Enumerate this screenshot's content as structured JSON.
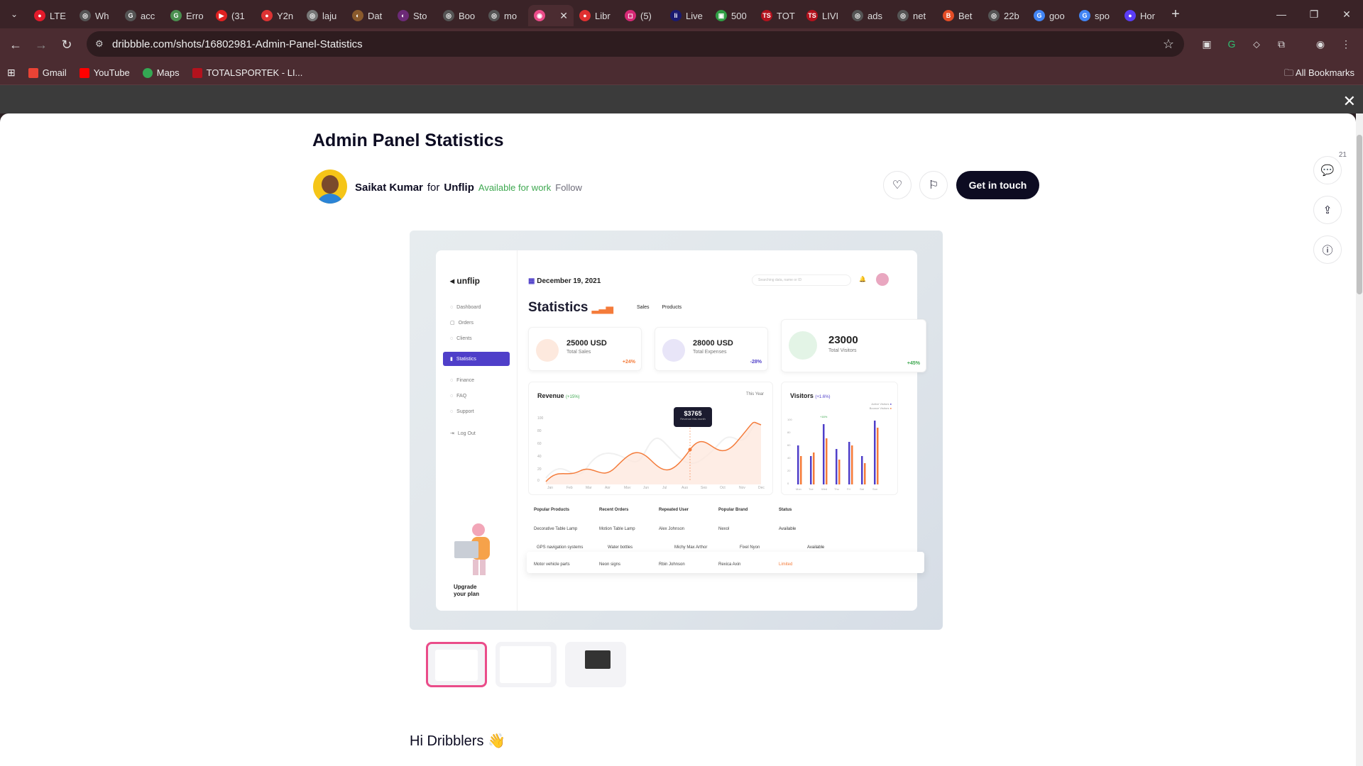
{
  "browser": {
    "tabs": [
      {
        "label": "LTE",
        "color": "#e21b2b",
        "glyph": "●"
      },
      {
        "label": "Wh",
        "color": "#555555",
        "glyph": "◎"
      },
      {
        "label": "acc",
        "color": "#555555",
        "glyph": "G"
      },
      {
        "label": "Erro",
        "color": "#4a8f4f",
        "glyph": "G"
      },
      {
        "label": "(31",
        "color": "#e02121",
        "glyph": "▶"
      },
      {
        "label": "Y2n",
        "color": "#d33",
        "glyph": "●"
      },
      {
        "label": "laju",
        "color": "#777777",
        "glyph": "◎"
      },
      {
        "label": "Dat",
        "color": "#8a5a2c",
        "glyph": "◐"
      },
      {
        "label": "Sto",
        "color": "#6c2a77",
        "glyph": "◐"
      },
      {
        "label": "Boo",
        "color": "#555555",
        "glyph": "◎"
      },
      {
        "label": "mo",
        "color": "#555555",
        "glyph": "◎"
      },
      {
        "label": "",
        "color": "#ea4c89",
        "glyph": "◉",
        "active": true
      },
      {
        "label": "Libr",
        "color": "#e03030",
        "glyph": "●"
      },
      {
        "label": "(5)",
        "color": "#d62976",
        "glyph": "◻"
      },
      {
        "label": "Live",
        "color": "#1a1a70",
        "glyph": "li"
      },
      {
        "label": "500",
        "color": "#2f9e44",
        "glyph": "▣"
      },
      {
        "label": "TOT",
        "color": "#b3121d",
        "glyph": "TS"
      },
      {
        "label": "LIVI",
        "color": "#b3121d",
        "glyph": "TS"
      },
      {
        "label": "ads",
        "color": "#555555",
        "glyph": "◎"
      },
      {
        "label": "net",
        "color": "#555555",
        "glyph": "◎"
      },
      {
        "label": "Bet",
        "color": "#e44d26",
        "glyph": "B"
      },
      {
        "label": "22b",
        "color": "#555555",
        "glyph": "◎"
      },
      {
        "label": "goo",
        "color": "#4285f4",
        "glyph": "G"
      },
      {
        "label": "spo",
        "color": "#4285f4",
        "glyph": "G"
      },
      {
        "label": "Hor",
        "color": "#5b3df5",
        "glyph": "●"
      }
    ],
    "url": "dribbble.com/shots/16802981-Admin-Panel-Statistics",
    "bookmarks": [
      {
        "label": "Gmail",
        "color": "#ea4335"
      },
      {
        "label": "YouTube",
        "color": "#ff0000"
      },
      {
        "label": "Maps",
        "color": "#34a853"
      },
      {
        "label": "TOTALSPORTEK - LI...",
        "color": "#b3121d"
      }
    ],
    "all_bookmarks": "All Bookmarks"
  },
  "shot": {
    "title": "Admin Panel Statistics",
    "author": "Saikat Kumar",
    "for_word": "for",
    "team": "Unflip",
    "availability": "Available for work",
    "follow": "Follow",
    "contact": "Get in touch",
    "comment_count": "21",
    "intro": "Hi Dribblers 👋"
  },
  "dashboard": {
    "logo": "unflip",
    "date": "December 19, 2021",
    "search_placeholder": "Searching data, name or ID",
    "title": "Statistics",
    "tabs": [
      "Sales",
      "Products"
    ],
    "nav": [
      "Dashboard",
      "Orders",
      "Clients",
      "Statistics",
      "Finance",
      "FAQ",
      "Support",
      "Log Out"
    ],
    "kpis": [
      {
        "value": "25000 USD",
        "label": "Total Sales",
        "change": "+24%",
        "color": "#f47b3a"
      },
      {
        "value": "28000 USD",
        "label": "Total Expenses",
        "change": "-28%",
        "color": "#4f3fc9"
      },
      {
        "value": "23000",
        "label": "Total Visitors",
        "change": "+45%",
        "color": "#3ea850"
      }
    ],
    "revenue": {
      "title": "Revenue",
      "change": "(+15%)",
      "period": "This Year",
      "tooltip": "$3765",
      "tooltip_sub": "Revenue this month"
    },
    "visitors": {
      "title": "Visitors",
      "change": "(+1.6%)",
      "legend": [
        "Active Visitors",
        "Bounce Visitors"
      ]
    },
    "revenue_months": [
      "Jan",
      "Feb",
      "Mar",
      "Apr",
      "May",
      "Jun",
      "Jul",
      "Aug",
      "Sep",
      "Oct",
      "Nov",
      "Dec"
    ],
    "revenue_y": [
      "100",
      "80",
      "60",
      "40",
      "20",
      "0"
    ],
    "visitor_days": [
      "Mon",
      "Tue",
      "Wed",
      "Thu",
      "Fri",
      "Sat",
      "Sun"
    ],
    "visitor_y": [
      "100",
      "80",
      "60",
      "40",
      "20",
      "0"
    ],
    "visitor_peak": "+16%",
    "table_headers": [
      "Popular Products",
      "Recent Orders",
      "Repeated User",
      "Popular Brand",
      "Status"
    ],
    "rows": [
      [
        "Decorative Table Lamp",
        "Motion Table Lamp",
        "Alex Johnson",
        "Nexol",
        "Available"
      ],
      [
        "GPS navigation systems",
        "Water bottles",
        "Michy Max Arthor",
        "Fixel Nyon",
        "Available"
      ],
      [
        "Motor vehicle parts",
        "Neon signs",
        "Rbin Johnson",
        "Rexica Axin",
        "Limited"
      ]
    ],
    "upgrade": [
      "Upgrade",
      "your plan"
    ]
  },
  "colors": {
    "accent": "#4f3fc9",
    "orange": "#f47b3a",
    "dribbble_pink": "#ea4c89",
    "dark": "#0d0c22"
  }
}
